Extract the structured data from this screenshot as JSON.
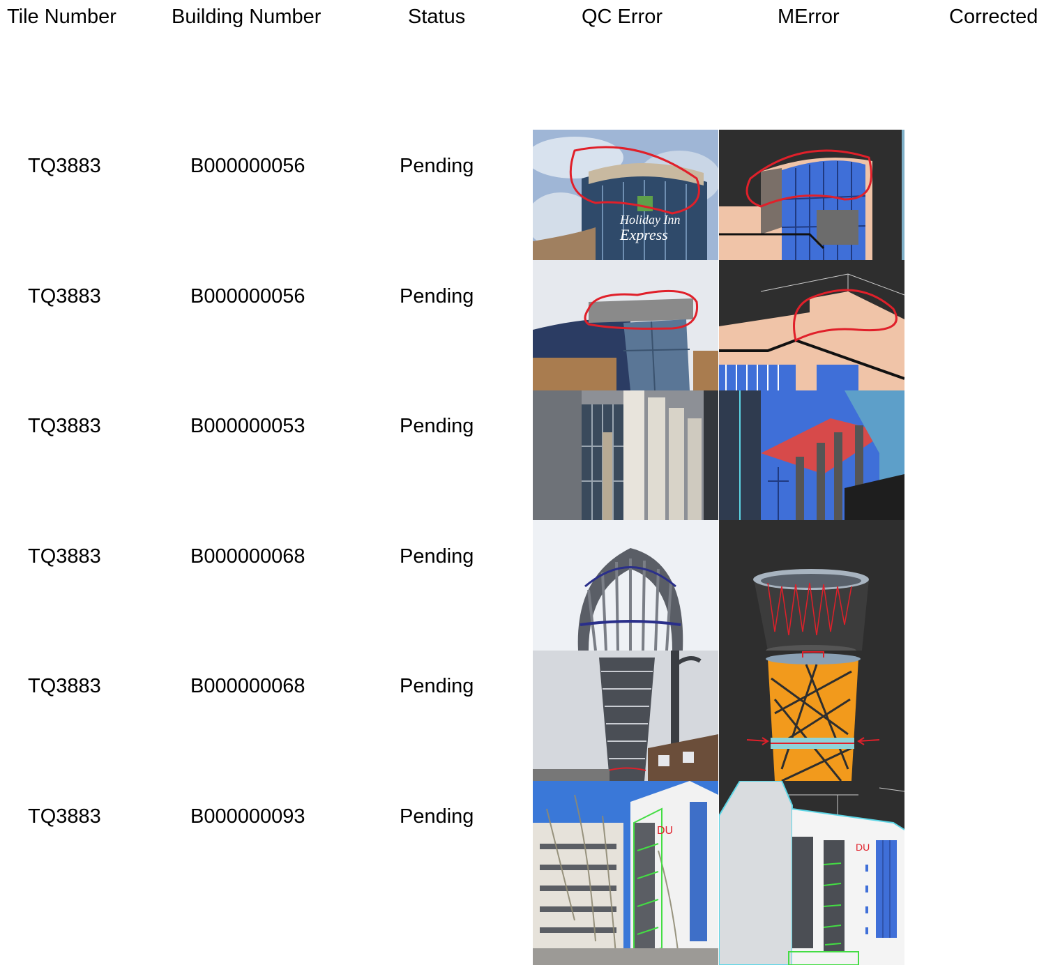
{
  "headers": {
    "tile": "Tile Number",
    "building": "Building Number",
    "status": "Status",
    "qc": "QC Error",
    "merror": "MError",
    "corrected": "Corrected"
  },
  "rows": [
    {
      "tile": "TQ3883",
      "building": "B000000056",
      "status": "Pending",
      "qc_image": "photo-holiday-inn-express-curved-roof",
      "m_image": "render-curved-roof-blue-glass"
    },
    {
      "tile": "TQ3883",
      "building": "B000000056",
      "status": "Pending",
      "qc_image": "photo-roof-overhang",
      "m_image": "render-roof-overhang-pink-facade"
    },
    {
      "tile": "TQ3883",
      "building": "B000000053",
      "status": "Pending",
      "qc_image": "photo-vertical-fins-facade",
      "m_image": "render-fins-red-canopy"
    },
    {
      "tile": "TQ3883",
      "building": "B000000068",
      "status": "Pending",
      "qc_image": "photo-lattice-tower-top",
      "m_image": "render-cylinder-red-zigzag"
    },
    {
      "tile": "TQ3883",
      "building": "B000000068",
      "status": "Pending",
      "qc_image": "photo-lattice-tower",
      "m_image": "render-orange-lattice-arrows"
    },
    {
      "tile": "TQ3883",
      "building": "B000000093",
      "status": "Pending",
      "qc_image": "photo-white-tower-green-markup",
      "m_image": "render-white-tower-green-markup"
    }
  ],
  "colors": {
    "markup_red": "#e0202a",
    "markup_green": "#44dd44",
    "render_bg": "#2e2e2e",
    "render_glass": "#3f6fd8",
    "render_facade": "#f0c4a8",
    "render_orange": "#f29a1c"
  }
}
